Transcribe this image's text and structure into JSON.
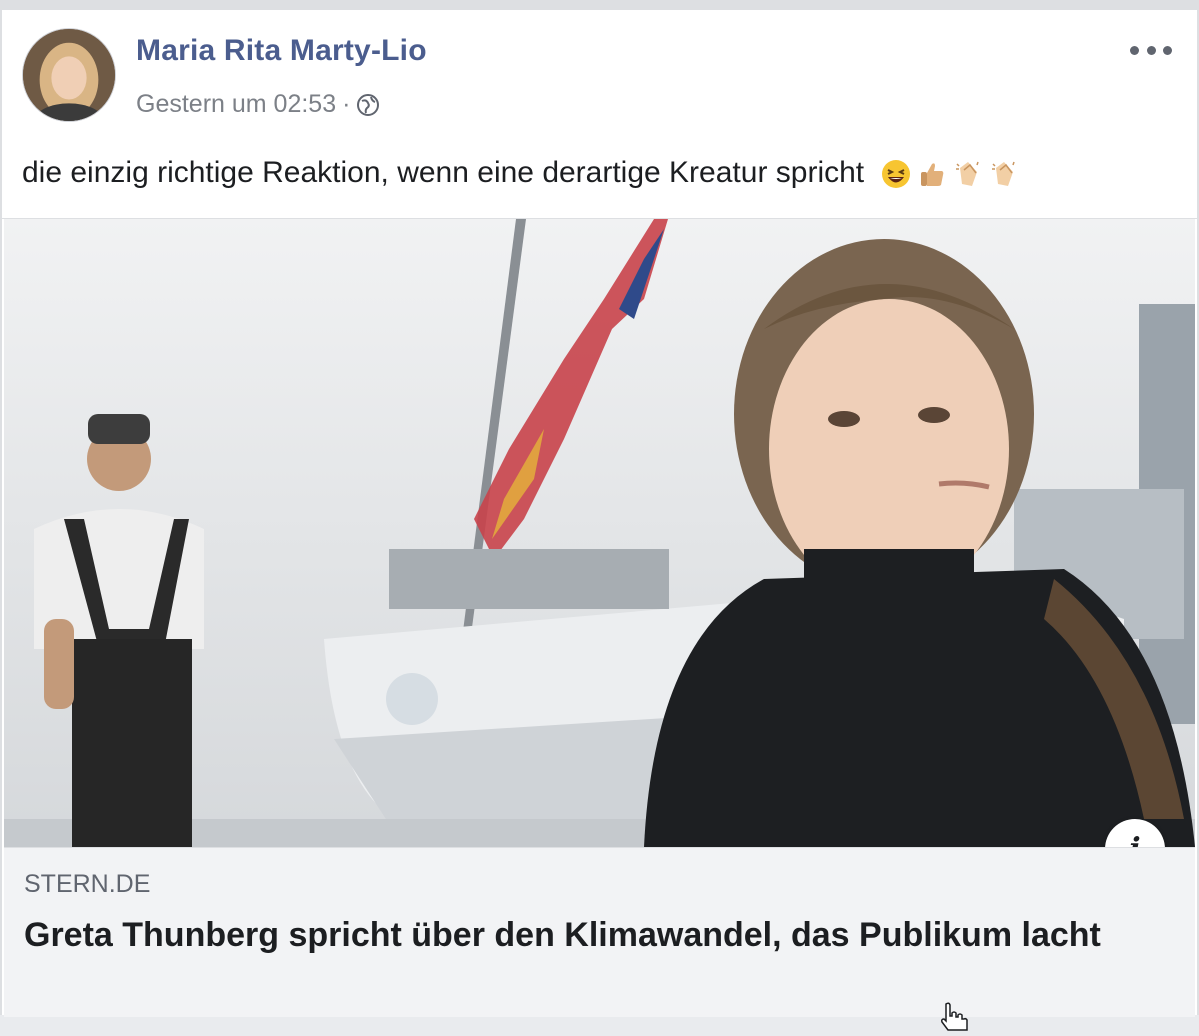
{
  "post": {
    "author": "Maria Rita Marty-Lio",
    "timestamp": "Gestern um 02:53",
    "separator": "·",
    "privacy_icon": "globe-icon",
    "more_icon": "more-options-icon",
    "text": "die einzig richtige Reaktion, wenn eine derartige Kreatur spricht",
    "emojis": [
      "laughing-emoji",
      "thumbs-up-emoji",
      "clapping-hands-emoji",
      "clapping-hands-emoji"
    ]
  },
  "link": {
    "domain": "STERN.DE",
    "title": "Greta Thunberg spricht über den Klimawandel, das Publikum lacht",
    "info_icon_glyph": "i"
  },
  "colors": {
    "author_name": "#4b5d8e",
    "meta_text": "#7c8087",
    "caption_background": "#f2f3f5"
  }
}
